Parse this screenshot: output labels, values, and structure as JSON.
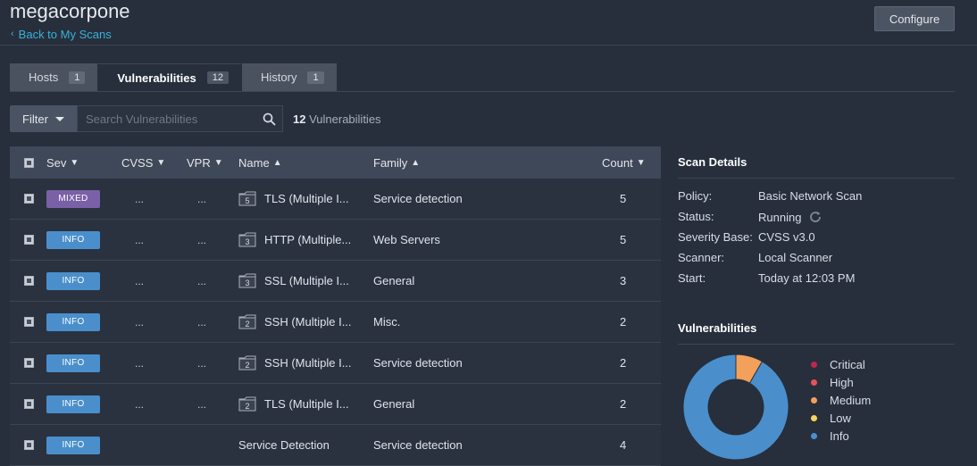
{
  "header": {
    "title": "megacorpone",
    "back_label": "Back to My Scans",
    "configure_label": "Configure"
  },
  "tabs": [
    {
      "label": "Hosts",
      "count": "1",
      "active": false
    },
    {
      "label": "Vulnerabilities",
      "count": "12",
      "active": true
    },
    {
      "label": "History",
      "count": "1",
      "active": false
    }
  ],
  "toolbar": {
    "filter_label": "Filter",
    "search_placeholder": "Search Vulnerabilities",
    "count_number": "12",
    "count_suffix": "Vulnerabilities"
  },
  "table": {
    "columns": {
      "sev": "Sev",
      "cvss": "CVSS",
      "vpr": "VPR",
      "name": "Name",
      "family": "Family",
      "count": "Count"
    },
    "rows": [
      {
        "sev": "MIXED",
        "sev_type": "mixed",
        "cvss": "...",
        "vpr": "...",
        "group": "5",
        "name": "TLS (Multiple I...",
        "family": "Service detection",
        "count": "5"
      },
      {
        "sev": "INFO",
        "sev_type": "info",
        "cvss": "...",
        "vpr": "...",
        "group": "3",
        "name": "HTTP (Multiple...",
        "family": "Web Servers",
        "count": "5"
      },
      {
        "sev": "INFO",
        "sev_type": "info",
        "cvss": "...",
        "vpr": "...",
        "group": "3",
        "name": "SSL (Multiple I...",
        "family": "General",
        "count": "3"
      },
      {
        "sev": "INFO",
        "sev_type": "info",
        "cvss": "...",
        "vpr": "...",
        "group": "2",
        "name": "SSH (Multiple I...",
        "family": "Misc.",
        "count": "2"
      },
      {
        "sev": "INFO",
        "sev_type": "info",
        "cvss": "...",
        "vpr": "...",
        "group": "2",
        "name": "SSH (Multiple I...",
        "family": "Service detection",
        "count": "2"
      },
      {
        "sev": "INFO",
        "sev_type": "info",
        "cvss": "...",
        "vpr": "...",
        "group": "2",
        "name": "TLS (Multiple I...",
        "family": "General",
        "count": "2"
      },
      {
        "sev": "INFO",
        "sev_type": "info",
        "cvss": "",
        "vpr": "",
        "group": "",
        "name": "Service Detection",
        "family": "Service detection",
        "count": "4"
      }
    ]
  },
  "scan_details": {
    "title": "Scan Details",
    "items": [
      {
        "key": "Policy:",
        "value": "Basic Network Scan"
      },
      {
        "key": "Status:",
        "value": "Running",
        "icon": "refresh-icon"
      },
      {
        "key": "Severity Base:",
        "value": "CVSS v3.0"
      },
      {
        "key": "Scanner:",
        "value": "Local Scanner"
      },
      {
        "key": "Start:",
        "value": "Today at 12:03 PM"
      }
    ]
  },
  "vulnerabilities_panel": {
    "title": "Vulnerabilities",
    "legend": [
      {
        "label": "Critical",
        "color": "#c0264b"
      },
      {
        "label": "High",
        "color": "#e8525c"
      },
      {
        "label": "Medium",
        "color": "#f2a05a"
      },
      {
        "label": "Low",
        "color": "#f6d55c"
      },
      {
        "label": "Info",
        "color": "#4a8fcb"
      }
    ],
    "chart_data": {
      "type": "pie",
      "categories": [
        "Critical",
        "High",
        "Medium",
        "Low",
        "Info"
      ],
      "values": [
        0,
        0,
        1,
        0,
        11
      ]
    }
  },
  "colors": {
    "accent": "#3ab0d6",
    "background": "#272f3d",
    "info": "#4a8fcb",
    "mixed": "#7a60a6"
  }
}
